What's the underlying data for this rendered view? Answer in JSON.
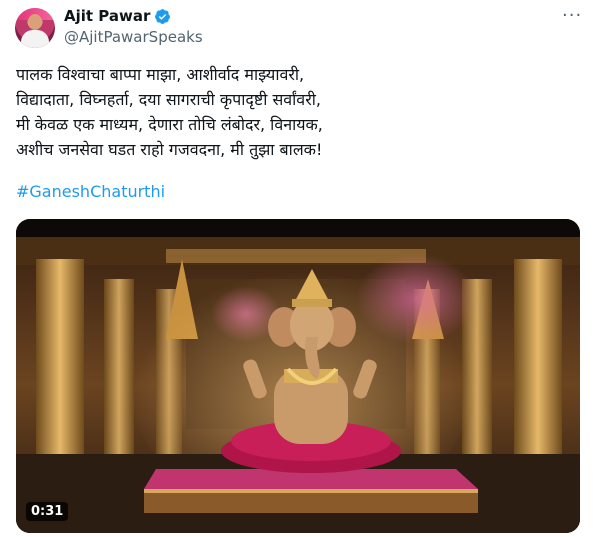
{
  "author": {
    "name": "Ajit Pawar",
    "handle": "@AjitPawarSpeaks"
  },
  "tweet": {
    "lines": [
      "पालक विश्वाचा बाप्पा माझा, आशीर्वाद माझ्यावरी,",
      "विद्यादाता, विघ्नहर्ता, दया सागराची कृपादृष्टी सर्वांवरी,",
      "मी केवळ एक माध्यम, देणारा तोचि लंबोदर, विनायक,",
      "अशीच जनसेवा घडत राहो गजवदना, मी तुझा बालक!"
    ],
    "hashtag": "#GaneshChaturthi"
  },
  "media": {
    "duration": "0:31"
  },
  "colors": {
    "link": "#1d9bf0",
    "verified": "#1d9bf0",
    "secondary_text": "#536471"
  },
  "icons": [
    "verified-badge-icon",
    "more-options-icon"
  ]
}
